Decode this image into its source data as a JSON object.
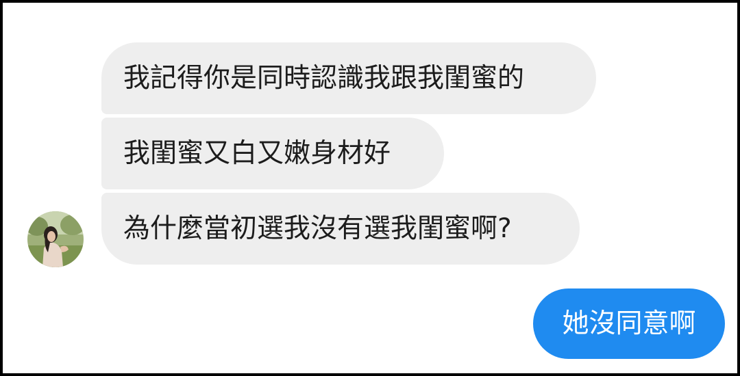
{
  "conversation": {
    "incoming_messages": [
      {
        "text": "我記得你是同時認識我跟我閨蜜的"
      },
      {
        "text": "我閨蜜又白又嫩身材好"
      },
      {
        "text": "為什麼當初選我沒有選我閨蜜啊?"
      }
    ],
    "outgoing_messages": [
      {
        "text": "她沒同意啊"
      }
    ],
    "contact": {
      "avatar_icon": "profile-photo-avatar"
    }
  },
  "colors": {
    "incoming_bubble": "#eeeeee",
    "outgoing_bubble": "#1f8bf0",
    "incoming_text": "#1c1c1c",
    "outgoing_text": "#ffffff"
  }
}
